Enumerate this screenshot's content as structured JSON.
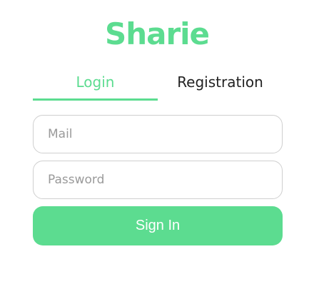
{
  "app": {
    "logo_text": "Sharie"
  },
  "tabs": [
    {
      "label": "Login",
      "active": true
    },
    {
      "label": "Registration",
      "active": false
    }
  ],
  "form": {
    "mail": {
      "placeholder": "Mail",
      "value": ""
    },
    "password": {
      "placeholder": "Password",
      "value": ""
    },
    "submit_label": "Sign In"
  },
  "colors": {
    "accent": "#5cdc90",
    "border": "#cfcfcf",
    "text": "#222222",
    "placeholder": "#9a9a9a"
  }
}
